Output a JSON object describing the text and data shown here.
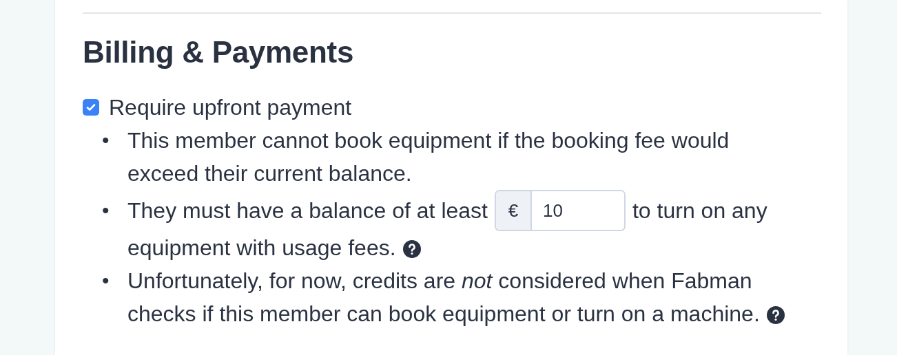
{
  "section": {
    "title": "Billing & Payments"
  },
  "upfront_payment": {
    "label": "Require upfront payment",
    "checked": true
  },
  "notes": [
    {
      "kind": "text",
      "bullet": "•",
      "text": "This member cannot book equipment if the booking fee would exceed their current balance.",
      "help": false
    },
    {
      "kind": "amount",
      "bullet": "•",
      "before": "They must have a balance of at least",
      "currency": "€",
      "value": "10",
      "after": "to turn on any",
      "after_continued": "equipment with usage fees.",
      "help": true
    },
    {
      "kind": "text",
      "bullet": "•",
      "text": "Unfortunately, for now, credits are *not* considered when Fabman checks if this member can book equipment or turn on a machine.",
      "help": true
    }
  ]
}
